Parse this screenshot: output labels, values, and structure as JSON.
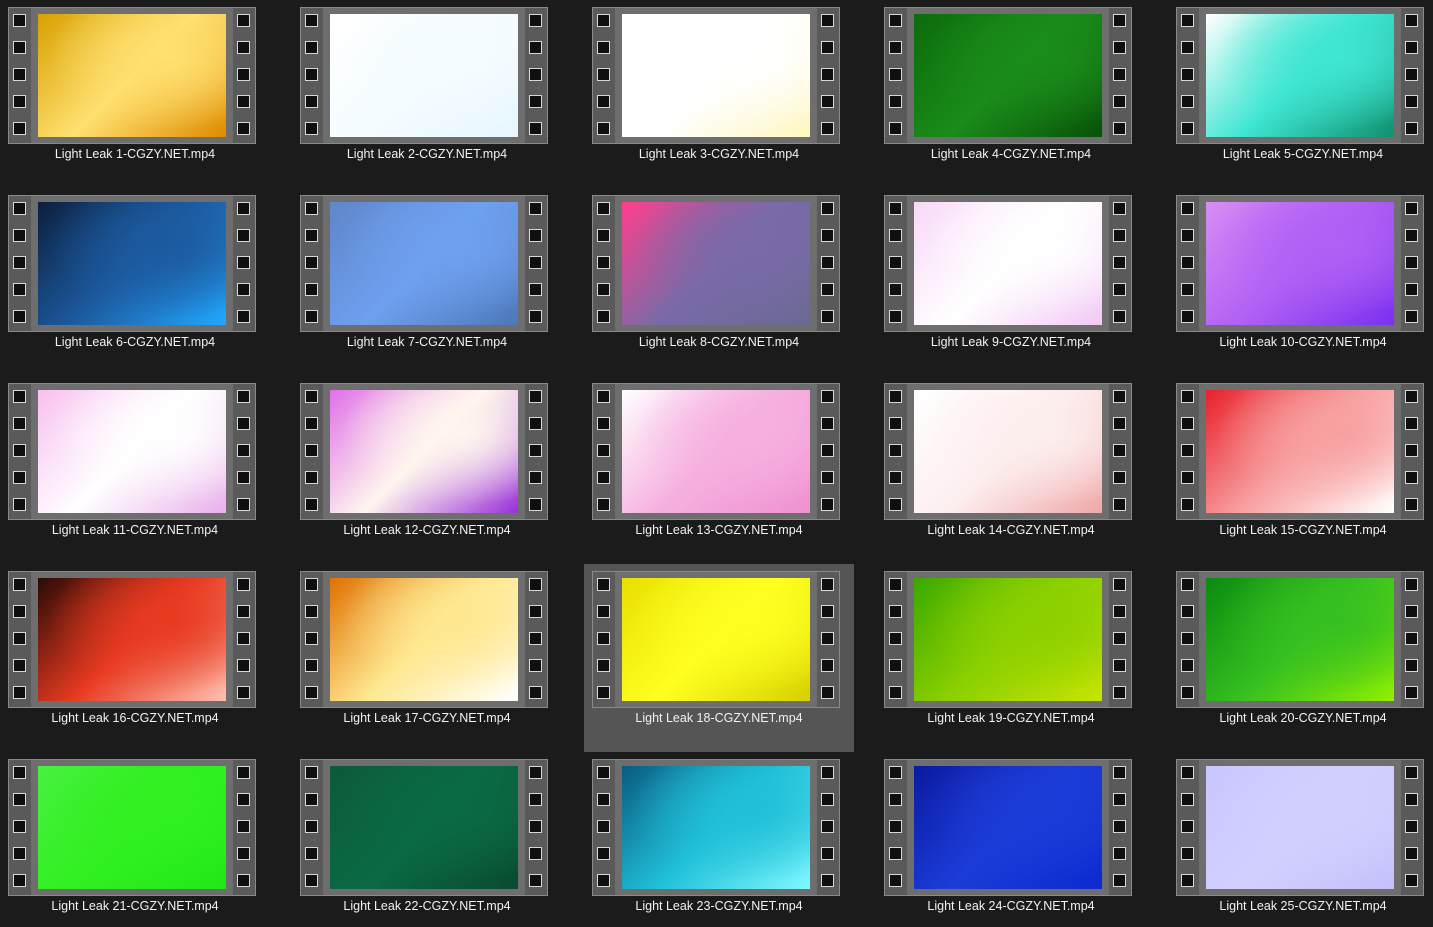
{
  "selected_index": 17,
  "items": [
    {
      "name": "Light Leak 1-CGZY.NET.mp4",
      "colors": [
        "#d8a000",
        "#ffe070",
        "#e08a00"
      ]
    },
    {
      "name": "Light Leak 2-CGZY.NET.mp4",
      "colors": [
        "#ffffff",
        "#f4fcff",
        "#e6f6ff"
      ]
    },
    {
      "name": "Light Leak 3-CGZY.NET.mp4",
      "colors": [
        "#ffffff",
        "#ffffff",
        "#fff6c0"
      ]
    },
    {
      "name": "Light Leak 4-CGZY.NET.mp4",
      "colors": [
        "#0b6b0b",
        "#1a8c1a",
        "#085208"
      ]
    },
    {
      "name": "Light Leak 5-CGZY.NET.mp4",
      "colors": [
        "#ffffff",
        "#3fe6d2",
        "#109070"
      ]
    },
    {
      "name": "Light Leak 6-CGZY.NET.mp4",
      "colors": [
        "#0c1f3c",
        "#1c5aa0",
        "#22a8ff"
      ]
    },
    {
      "name": "Light Leak 7-CGZY.NET.mp4",
      "colors": [
        "#5f86c8",
        "#6ea0f0",
        "#4d78b8"
      ]
    },
    {
      "name": "Light Leak 8-CGZY.NET.mp4",
      "colors": [
        "#ff3f8c",
        "#7a6aa8",
        "#6a6a92"
      ]
    },
    {
      "name": "Light Leak 9-CGZY.NET.mp4",
      "colors": [
        "#f8d8f8",
        "#ffffff",
        "#f3c8f6"
      ]
    },
    {
      "name": "Light Leak 10-CGZY.NET.mp4",
      "colors": [
        "#d88cf4",
        "#b060f4",
        "#7a30f0"
      ]
    },
    {
      "name": "Light Leak 11-CGZY.NET.mp4",
      "colors": [
        "#f8bff0",
        "#ffffff",
        "#eab0ec"
      ]
    },
    {
      "name": "Light Leak 12-CGZY.NET.mp4",
      "colors": [
        "#e070e8",
        "#fff6ee",
        "#9a30d8"
      ]
    },
    {
      "name": "Light Leak 13-CGZY.NET.mp4",
      "colors": [
        "#ffffff",
        "#f6b0e0",
        "#f090d0"
      ]
    },
    {
      "name": "Light Leak 14-CGZY.NET.mp4",
      "colors": [
        "#ffffff",
        "#fdeeee",
        "#f0a8a8"
      ]
    },
    {
      "name": "Light Leak 15-CGZY.NET.mp4",
      "colors": [
        "#e8202a",
        "#f8a0a0",
        "#ffffff"
      ]
    },
    {
      "name": "Light Leak 16-CGZY.NET.mp4",
      "colors": [
        "#2a0a06",
        "#e83a20",
        "#ffc0b0"
      ]
    },
    {
      "name": "Light Leak 17-CGZY.NET.mp4",
      "colors": [
        "#e07000",
        "#ffe890",
        "#ffffff"
      ]
    },
    {
      "name": "Light Leak 18-CGZY.NET.mp4",
      "colors": [
        "#e8e000",
        "#ffff20",
        "#d6d000"
      ]
    },
    {
      "name": "Light Leak 19-CGZY.NET.mp4",
      "colors": [
        "#3aa800",
        "#8cd000",
        "#c8e400"
      ]
    },
    {
      "name": "Light Leak 20-CGZY.NET.mp4",
      "colors": [
        "#0a8a10",
        "#36c020",
        "#90f000"
      ]
    },
    {
      "name": "Light Leak 21-CGZY.NET.mp4",
      "colors": [
        "#48f040",
        "#30f020",
        "#22e818"
      ]
    },
    {
      "name": "Light Leak 22-CGZY.NET.mp4",
      "colors": [
        "#0c5a3a",
        "#0a6a44",
        "#0a4a30"
      ]
    },
    {
      "name": "Light Leak 23-CGZY.NET.mp4",
      "colors": [
        "#0a5a80",
        "#20c0d8",
        "#80f8ff"
      ]
    },
    {
      "name": "Light Leak 24-CGZY.NET.mp4",
      "colors": [
        "#0a1aa0",
        "#1c3cd8",
        "#0c2ad0"
      ]
    },
    {
      "name": "Light Leak 25-CGZY.NET.mp4",
      "colors": [
        "#c8c6ff",
        "#d2d0ff",
        "#c4c0fa"
      ]
    }
  ]
}
